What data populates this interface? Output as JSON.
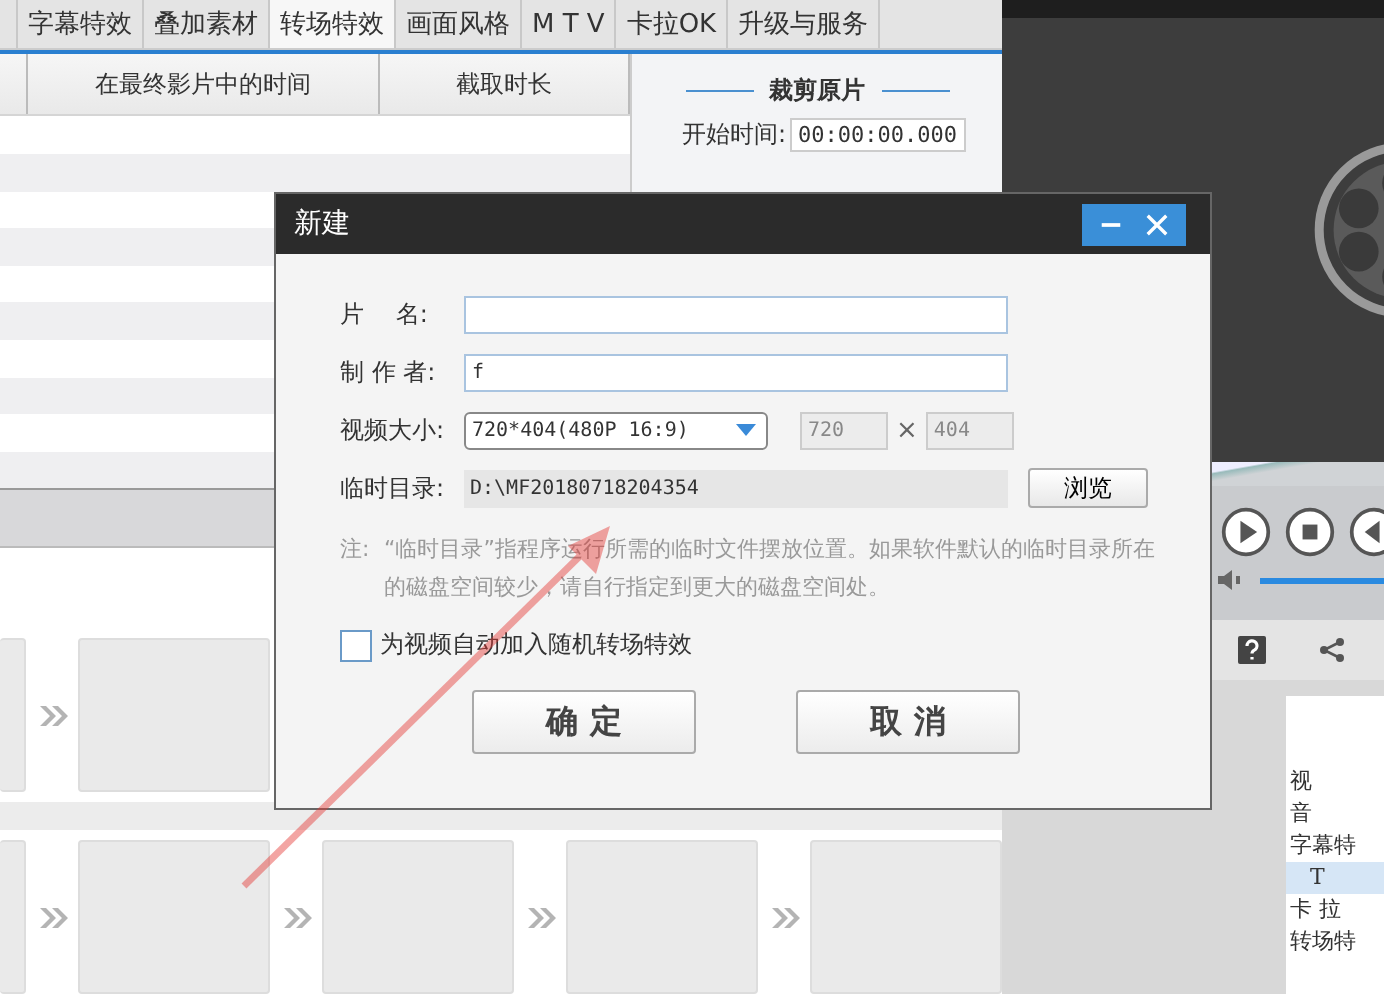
{
  "tabs": [
    {
      "label": "字幕特效",
      "selected": false
    },
    {
      "label": "叠加素材",
      "selected": false
    },
    {
      "label": "转场特效",
      "selected": true
    },
    {
      "label": "画面风格",
      "selected": false
    },
    {
      "label": "M T V",
      "selected": false
    },
    {
      "label": "卡拉OK",
      "selected": false
    },
    {
      "label": "升级与服务",
      "selected": false
    }
  ],
  "table": {
    "columns": [
      "在最终影片中的时间",
      "截取时长"
    ]
  },
  "crop_panel": {
    "title": "裁剪原片",
    "start_label": "开始时间:",
    "start_value": "00:00:00.000"
  },
  "volume": {
    "level": 1
  },
  "side_list": [
    {
      "label": "视",
      "selected": false
    },
    {
      "label": "音",
      "selected": false
    },
    {
      "label": "字幕特",
      "selected": false
    },
    {
      "label": "T",
      "selected": true
    },
    {
      "label": "卡 拉",
      "selected": false
    },
    {
      "label": "转场特",
      "selected": false
    }
  ],
  "dialog": {
    "title": "新建",
    "name_label": "片　 名:",
    "author_label": "制 作 者:",
    "author_value": "f",
    "size_label": "视频大小:",
    "size_value": "720*404(480P 16:9)",
    "width_value": "720",
    "times": "×",
    "height_value": "404",
    "dir_label": "临时目录:",
    "dir_value": "D:\\MF20180718204354",
    "browse": "浏览",
    "note_label": "注:",
    "note_text": "“临时目录”指程序运行所需的临时文件摆放位置。如果软件默认的临时目录所在的磁盘空间较少，请自行指定到更大的磁盘空间处。",
    "checkbox": {
      "label": "为视频自动加入随机转场特效",
      "checked": false
    },
    "ok": "确 定",
    "cancel": "取 消"
  }
}
